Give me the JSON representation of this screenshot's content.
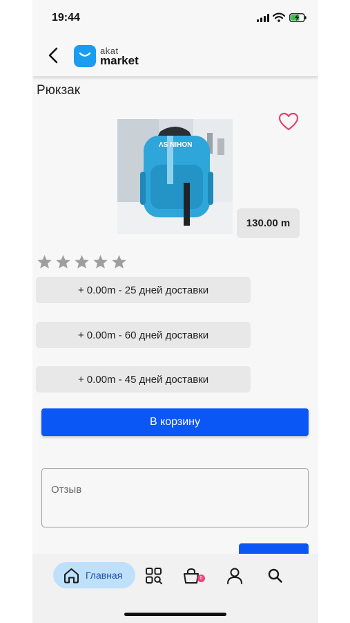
{
  "status_bar": {
    "time": "19:44"
  },
  "header": {
    "logo_top": "akat",
    "logo_bottom": "market"
  },
  "product": {
    "title": "Рюкзак",
    "price": "130.00 m",
    "rating_stars": 5,
    "rating_filled": 0
  },
  "delivery_options": [
    "+ 0.00m - 25 дней доставки",
    "+ 0.00m - 60 дней доставки",
    "+ 0.00m - 45 дней доставки"
  ],
  "actions": {
    "add_to_cart": "В корзину"
  },
  "review": {
    "placeholder": "Отзыв"
  },
  "bottom_nav": {
    "home_label": "Главная",
    "cart_count": "0"
  },
  "colors": {
    "accent": "#0a57f5",
    "nav_active_bg": "#bfe0fb",
    "heart": "#e8406e",
    "star": "#9e9e9e"
  }
}
